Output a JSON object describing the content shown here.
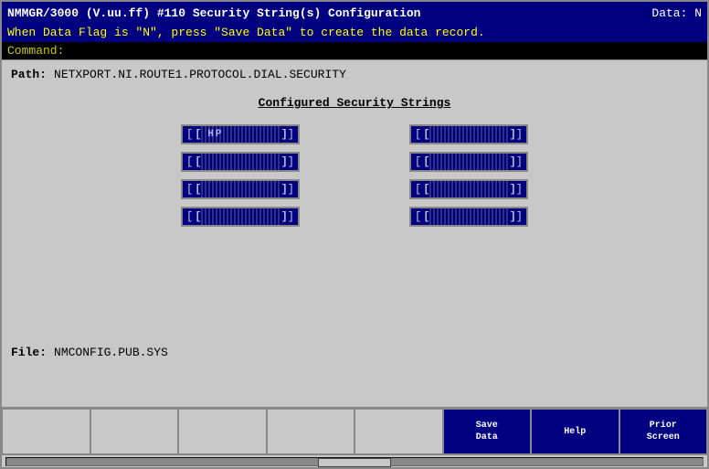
{
  "titleBar": {
    "left": "NMMGR/3000 (V.uu.ff) #110  Security String(s) Configuration",
    "right": "Data: N"
  },
  "infoBar": {
    "message": "When Data Flag is \"N\", press \"Save Data\" to create the data record."
  },
  "commandBar": {
    "label": "Command:"
  },
  "path": {
    "label": "Path:",
    "value": "NETXPORT.NI.ROUTE1.PROTOCOL.DIAL.SECURITY"
  },
  "sectionTitle": "Configured Security Strings",
  "stringFields": {
    "left": [
      {
        "id": "l1",
        "value": "HP",
        "filled": true
      },
      {
        "id": "l2",
        "value": "",
        "filled": false
      },
      {
        "id": "l3",
        "value": "",
        "filled": false
      },
      {
        "id": "l4",
        "value": "",
        "filled": false
      }
    ],
    "right": [
      {
        "id": "r1",
        "value": "",
        "filled": false
      },
      {
        "id": "r2",
        "value": "",
        "filled": false
      },
      {
        "id": "r3",
        "value": "",
        "filled": false
      },
      {
        "id": "r4",
        "value": "",
        "filled": false
      }
    ]
  },
  "fileSection": {
    "label": "File:",
    "value": "NMCONFIG.PUB.SYS"
  },
  "functionKeys": [
    {
      "id": "f1",
      "label": "",
      "active": false
    },
    {
      "id": "f2",
      "label": "",
      "active": false
    },
    {
      "id": "f3",
      "label": "",
      "active": false
    },
    {
      "id": "f4",
      "label": "",
      "active": false
    },
    {
      "id": "f5",
      "label": "",
      "active": false
    },
    {
      "id": "f6",
      "label": "Save\nData",
      "active": true
    },
    {
      "id": "f7",
      "label": "Help",
      "active": true
    },
    {
      "id": "f8",
      "label": "Prior\nScreen",
      "active": true
    }
  ]
}
